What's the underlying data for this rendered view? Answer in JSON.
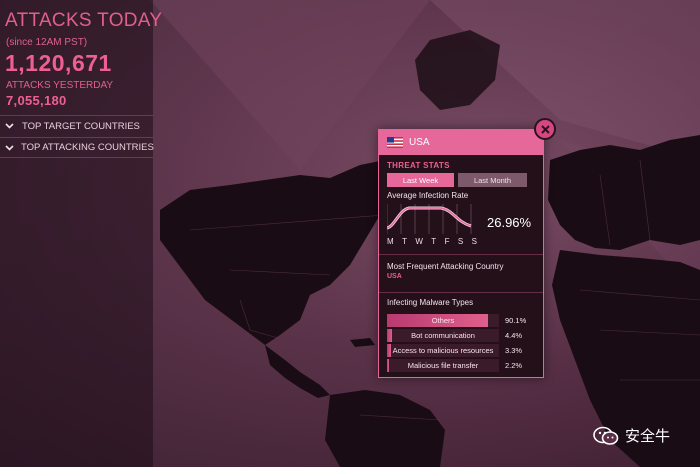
{
  "stats": {
    "attacks_today_label": "ATTACKS TODAY",
    "since_label": "(since 12AM PST)",
    "attacks_today_value": "1,120,671",
    "attacks_yesterday_label": "ATTACKS YESTERDAY",
    "attacks_yesterday_value": "7,055,180"
  },
  "menu": {
    "top_target": "TOP TARGET COUNTRIES",
    "top_attacking": "TOP ATTACKING COUNTRIES"
  },
  "popup": {
    "country": "USA",
    "threat_stats_label": "THREAT STATS",
    "tabs": [
      "Last Week",
      "Last Month"
    ],
    "active_tab": "Last Week",
    "infection_label": "Average Infection Rate",
    "infection_value": "26.96%",
    "days": [
      "M",
      "T",
      "W",
      "T",
      "F",
      "S",
      "S"
    ],
    "frequent_label": "Most Frequent Attacking Country",
    "frequent_value": "USA",
    "malware_label": "Infecting Malware Types",
    "malware": [
      {
        "name": "Others",
        "pct": "90.1%",
        "fraction": 0.901
      },
      {
        "name": "Bot communication",
        "pct": "4.4%",
        "fraction": 0.044
      },
      {
        "name": "Access to malicious resources",
        "pct": "3.3%",
        "fraction": 0.033
      },
      {
        "name": "Malicious file transfer",
        "pct": "2.2%",
        "fraction": 0.022
      }
    ]
  },
  "watermark": {
    "text": "安全牛"
  },
  "colors": {
    "accent": "#e6679a",
    "text_pink": "#ee5f92",
    "panel_bg": "#231019",
    "background": "#5a2f47"
  },
  "icons": {
    "close": "close-icon",
    "chevron": "chevron-down-icon",
    "flag": "us-flag-icon",
    "watermark": "wechat-icon"
  }
}
